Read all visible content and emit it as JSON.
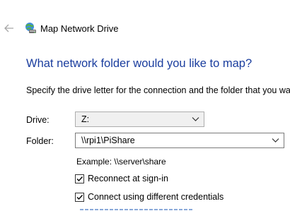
{
  "window": {
    "title": "Map Network Drive"
  },
  "page": {
    "heading": "What network folder would you like to map?",
    "instruction": "Specify the drive letter for the connection and the folder that you want"
  },
  "form": {
    "drive": {
      "label": "Drive:",
      "value": "Z:"
    },
    "folder": {
      "label": "Folder:",
      "value": "\\\\rpi1\\PiShare"
    },
    "example": "Example: \\\\server\\share",
    "reconnect": {
      "label": "Reconnect at sign-in",
      "checked": true
    },
    "credentials": {
      "label": "Connect using different credentials",
      "checked": true
    }
  },
  "colors": {
    "heading": "#1a3d9e",
    "link": "#3a6fc0"
  },
  "icons": {
    "back": "arrow-left-icon",
    "wizard": "network-drive-icon",
    "dropdown": "chevron-down-icon",
    "check": "checkmark-icon"
  }
}
